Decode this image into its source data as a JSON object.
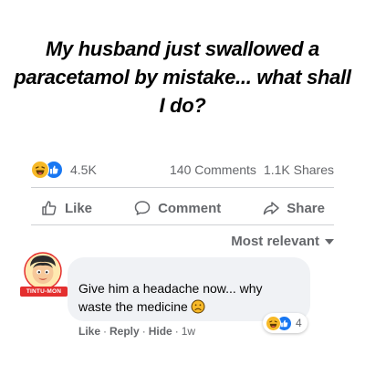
{
  "post": {
    "headline": "My husband just swallowed a paracetamol by mistake... what shall I do?"
  },
  "stats": {
    "reaction_icons": [
      "haha-icon",
      "like-icon"
    ],
    "reaction_count": "4.5K",
    "comments": "140 Comments",
    "shares": "1.1K Shares"
  },
  "actions": {
    "like": "Like",
    "comment": "Comment",
    "share": "Share"
  },
  "sort": {
    "label": "Most relevant"
  },
  "comment": {
    "avatar_badge": "TINTU-MON",
    "text": "Give him a headache now... why waste the medicine",
    "reaction_count": "4",
    "meta": {
      "like": "Like",
      "reply": "Reply",
      "hide": "Hide",
      "time": "1w",
      "sep": "·"
    }
  },
  "colors": {
    "brand_blue": "#1877f2",
    "haha_yellow": "#f7b928",
    "muted_text": "#65676b",
    "bubble_bg": "#f0f2f5",
    "badge_red": "#e42f2f"
  }
}
